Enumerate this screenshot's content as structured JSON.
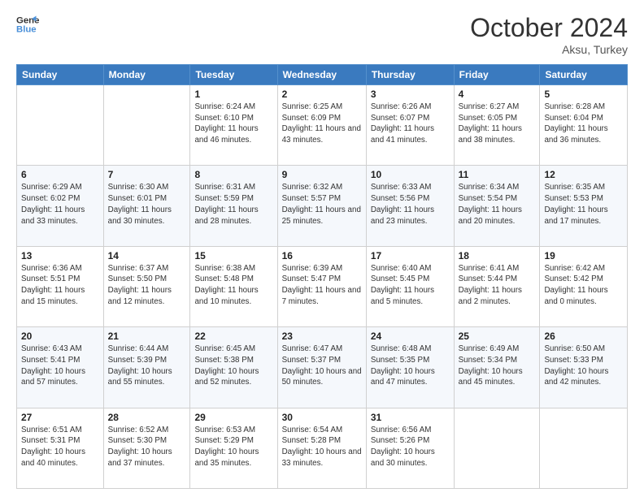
{
  "header": {
    "logo_line1": "General",
    "logo_line2": "Blue",
    "month": "October 2024",
    "location": "Aksu, Turkey"
  },
  "weekdays": [
    "Sunday",
    "Monday",
    "Tuesday",
    "Wednesday",
    "Thursday",
    "Friday",
    "Saturday"
  ],
  "weeks": [
    [
      null,
      null,
      {
        "day": 1,
        "sunrise": "Sunrise: 6:24 AM",
        "sunset": "Sunset: 6:10 PM",
        "daylight": "Daylight: 11 hours and 46 minutes."
      },
      {
        "day": 2,
        "sunrise": "Sunrise: 6:25 AM",
        "sunset": "Sunset: 6:09 PM",
        "daylight": "Daylight: 11 hours and 43 minutes."
      },
      {
        "day": 3,
        "sunrise": "Sunrise: 6:26 AM",
        "sunset": "Sunset: 6:07 PM",
        "daylight": "Daylight: 11 hours and 41 minutes."
      },
      {
        "day": 4,
        "sunrise": "Sunrise: 6:27 AM",
        "sunset": "Sunset: 6:05 PM",
        "daylight": "Daylight: 11 hours and 38 minutes."
      },
      {
        "day": 5,
        "sunrise": "Sunrise: 6:28 AM",
        "sunset": "Sunset: 6:04 PM",
        "daylight": "Daylight: 11 hours and 36 minutes."
      }
    ],
    [
      {
        "day": 6,
        "sunrise": "Sunrise: 6:29 AM",
        "sunset": "Sunset: 6:02 PM",
        "daylight": "Daylight: 11 hours and 33 minutes."
      },
      {
        "day": 7,
        "sunrise": "Sunrise: 6:30 AM",
        "sunset": "Sunset: 6:01 PM",
        "daylight": "Daylight: 11 hours and 30 minutes."
      },
      {
        "day": 8,
        "sunrise": "Sunrise: 6:31 AM",
        "sunset": "Sunset: 5:59 PM",
        "daylight": "Daylight: 11 hours and 28 minutes."
      },
      {
        "day": 9,
        "sunrise": "Sunrise: 6:32 AM",
        "sunset": "Sunset: 5:57 PM",
        "daylight": "Daylight: 11 hours and 25 minutes."
      },
      {
        "day": 10,
        "sunrise": "Sunrise: 6:33 AM",
        "sunset": "Sunset: 5:56 PM",
        "daylight": "Daylight: 11 hours and 23 minutes."
      },
      {
        "day": 11,
        "sunrise": "Sunrise: 6:34 AM",
        "sunset": "Sunset: 5:54 PM",
        "daylight": "Daylight: 11 hours and 20 minutes."
      },
      {
        "day": 12,
        "sunrise": "Sunrise: 6:35 AM",
        "sunset": "Sunset: 5:53 PM",
        "daylight": "Daylight: 11 hours and 17 minutes."
      }
    ],
    [
      {
        "day": 13,
        "sunrise": "Sunrise: 6:36 AM",
        "sunset": "Sunset: 5:51 PM",
        "daylight": "Daylight: 11 hours and 15 minutes."
      },
      {
        "day": 14,
        "sunrise": "Sunrise: 6:37 AM",
        "sunset": "Sunset: 5:50 PM",
        "daylight": "Daylight: 11 hours and 12 minutes."
      },
      {
        "day": 15,
        "sunrise": "Sunrise: 6:38 AM",
        "sunset": "Sunset: 5:48 PM",
        "daylight": "Daylight: 11 hours and 10 minutes."
      },
      {
        "day": 16,
        "sunrise": "Sunrise: 6:39 AM",
        "sunset": "Sunset: 5:47 PM",
        "daylight": "Daylight: 11 hours and 7 minutes."
      },
      {
        "day": 17,
        "sunrise": "Sunrise: 6:40 AM",
        "sunset": "Sunset: 5:45 PM",
        "daylight": "Daylight: 11 hours and 5 minutes."
      },
      {
        "day": 18,
        "sunrise": "Sunrise: 6:41 AM",
        "sunset": "Sunset: 5:44 PM",
        "daylight": "Daylight: 11 hours and 2 minutes."
      },
      {
        "day": 19,
        "sunrise": "Sunrise: 6:42 AM",
        "sunset": "Sunset: 5:42 PM",
        "daylight": "Daylight: 11 hours and 0 minutes."
      }
    ],
    [
      {
        "day": 20,
        "sunrise": "Sunrise: 6:43 AM",
        "sunset": "Sunset: 5:41 PM",
        "daylight": "Daylight: 10 hours and 57 minutes."
      },
      {
        "day": 21,
        "sunrise": "Sunrise: 6:44 AM",
        "sunset": "Sunset: 5:39 PM",
        "daylight": "Daylight: 10 hours and 55 minutes."
      },
      {
        "day": 22,
        "sunrise": "Sunrise: 6:45 AM",
        "sunset": "Sunset: 5:38 PM",
        "daylight": "Daylight: 10 hours and 52 minutes."
      },
      {
        "day": 23,
        "sunrise": "Sunrise: 6:47 AM",
        "sunset": "Sunset: 5:37 PM",
        "daylight": "Daylight: 10 hours and 50 minutes."
      },
      {
        "day": 24,
        "sunrise": "Sunrise: 6:48 AM",
        "sunset": "Sunset: 5:35 PM",
        "daylight": "Daylight: 10 hours and 47 minutes."
      },
      {
        "day": 25,
        "sunrise": "Sunrise: 6:49 AM",
        "sunset": "Sunset: 5:34 PM",
        "daylight": "Daylight: 10 hours and 45 minutes."
      },
      {
        "day": 26,
        "sunrise": "Sunrise: 6:50 AM",
        "sunset": "Sunset: 5:33 PM",
        "daylight": "Daylight: 10 hours and 42 minutes."
      }
    ],
    [
      {
        "day": 27,
        "sunrise": "Sunrise: 6:51 AM",
        "sunset": "Sunset: 5:31 PM",
        "daylight": "Daylight: 10 hours and 40 minutes."
      },
      {
        "day": 28,
        "sunrise": "Sunrise: 6:52 AM",
        "sunset": "Sunset: 5:30 PM",
        "daylight": "Daylight: 10 hours and 37 minutes."
      },
      {
        "day": 29,
        "sunrise": "Sunrise: 6:53 AM",
        "sunset": "Sunset: 5:29 PM",
        "daylight": "Daylight: 10 hours and 35 minutes."
      },
      {
        "day": 30,
        "sunrise": "Sunrise: 6:54 AM",
        "sunset": "Sunset: 5:28 PM",
        "daylight": "Daylight: 10 hours and 33 minutes."
      },
      {
        "day": 31,
        "sunrise": "Sunrise: 6:56 AM",
        "sunset": "Sunset: 5:26 PM",
        "daylight": "Daylight: 10 hours and 30 minutes."
      },
      null,
      null
    ]
  ]
}
